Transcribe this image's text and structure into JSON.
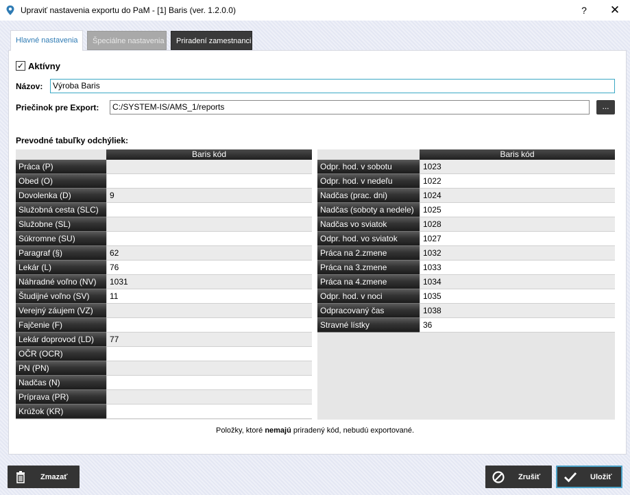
{
  "window": {
    "title": "Upraviť nastavenia exportu do PaM - [1] Baris (ver. 1.2.0.0)",
    "help": "?",
    "close": "✕"
  },
  "tabs": [
    {
      "label": "Hlavné nastavenia",
      "active": true
    },
    {
      "label": "Špeciálne nastavenia",
      "active": false
    },
    {
      "label": "Priradení zamestnanci",
      "active": false
    }
  ],
  "form": {
    "active_label": "Aktívny",
    "active_checked": true,
    "name_label": "Názov:",
    "name_value": "Výroba Baris",
    "folder_label": "Priečinok pre Export:",
    "folder_value": "C:/SYSTEM-IS/AMS_1/reports",
    "browse_label": "..."
  },
  "tables": {
    "heading": "Prevodné tabuľky odchýliek:",
    "column_header": "Baris kód",
    "left_rows": [
      {
        "label": "Práca  (P)",
        "value": ""
      },
      {
        "label": "Obed  (O)",
        "value": ""
      },
      {
        "label": "Dovolenka  (D)",
        "value": "9"
      },
      {
        "label": "Služobná cesta  (SLC)",
        "value": ""
      },
      {
        "label": "Služobne  (SL)",
        "value": ""
      },
      {
        "label": "Súkromne  (SU)",
        "value": ""
      },
      {
        "label": "Paragraf  (§)",
        "value": "62"
      },
      {
        "label": "Lekár  (L)",
        "value": "76"
      },
      {
        "label": "Náhradné voľno  (NV)",
        "value": "1031"
      },
      {
        "label": "Študijné voľno  (SV)",
        "value": "11"
      },
      {
        "label": "Verejný záujem  (VZ)",
        "value": ""
      },
      {
        "label": "Fajčenie  (F)",
        "value": ""
      },
      {
        "label": "Lekár doprovod  (LD)",
        "value": "77"
      },
      {
        "label": "OČR  (OCR)",
        "value": ""
      },
      {
        "label": "PN  (PN)",
        "value": ""
      },
      {
        "label": "Nadčas  (N)",
        "value": ""
      },
      {
        "label": "Príprava  (PR)",
        "value": ""
      },
      {
        "label": "Krúžok  (KR)",
        "value": ""
      }
    ],
    "right_rows": [
      {
        "label": "Odpr. hod. v sobotu",
        "value": "1023"
      },
      {
        "label": "Odpr. hod. v nedeľu",
        "value": "1022"
      },
      {
        "label": "Nadčas (prac. dni)",
        "value": "1024"
      },
      {
        "label": "Nadčas (soboty a nedele)",
        "value": "1025"
      },
      {
        "label": "Nadčas vo sviatok",
        "value": "1028"
      },
      {
        "label": "Odpr. hod. vo sviatok",
        "value": "1027"
      },
      {
        "label": "Práca na 2.zmene",
        "value": "1032"
      },
      {
        "label": "Práca na 3.zmene",
        "value": "1033"
      },
      {
        "label": "Práca na 4.zmene",
        "value": "1034"
      },
      {
        "label": "Odpr. hod. v noci",
        "value": "1035"
      },
      {
        "label": "Odpracovaný čas",
        "value": "1038"
      },
      {
        "label": "Stravné lístky",
        "value": "36"
      }
    ]
  },
  "note": {
    "before": "Položky, ktoré ",
    "bold": "nemajú",
    "after": " priradený kód, nebudú exportované."
  },
  "buttons": {
    "delete": "Zmazať",
    "cancel": "Zrušiť",
    "save": "Uložiť"
  },
  "icons": {
    "app": "location-pin-icon",
    "delete": "trash-icon",
    "cancel": "no-entry-icon",
    "save": "checkmark-icon"
  },
  "colors": {
    "accent": "#3aa7c4",
    "tab_active_text": "#2e7bb4",
    "button_bg": "#343434"
  }
}
